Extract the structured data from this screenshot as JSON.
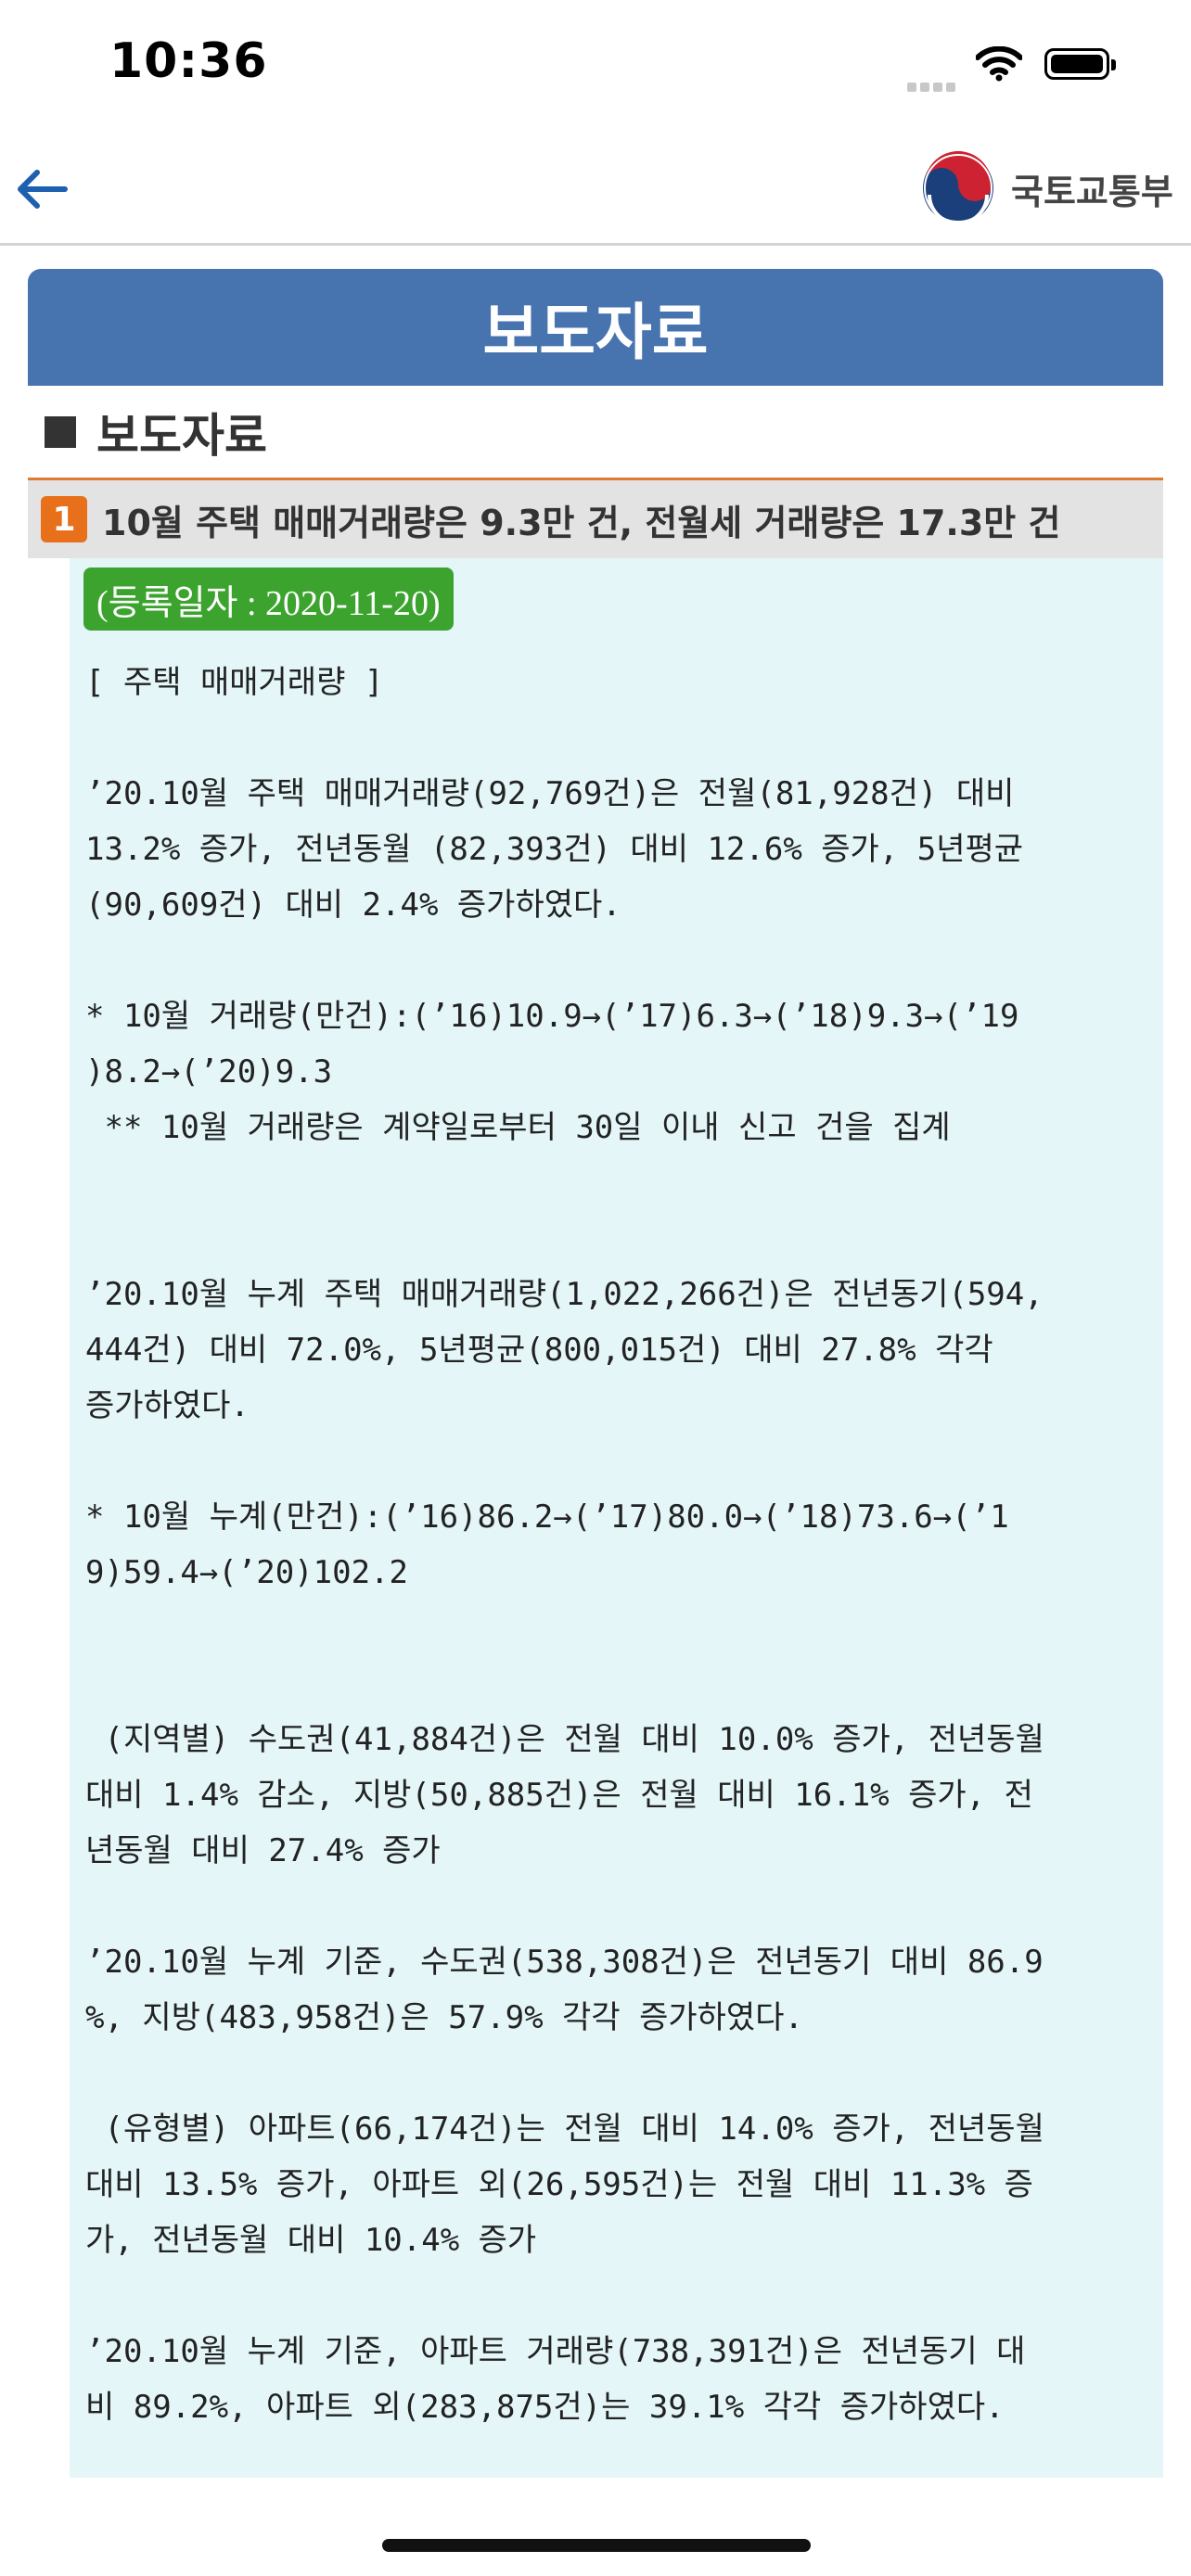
{
  "status_bar": {
    "time": "10:36"
  },
  "header": {
    "logo_text": "국토교통부"
  },
  "page": {
    "title": "보도자료",
    "section_heading": "보도자료"
  },
  "article": {
    "number": "1",
    "title": "10월 주택 매매거래량은 9.3만 건, 전월세 거래량은 17.3만 건",
    "date": "(등록일자 : 2020-11-20)",
    "paragraphs": [
      "[ 주택 매매거래량 ]",
      "’20.10월 주택 매매거래량(92,769건)은 전월(81,928건) 대비\n13.2% 증가, 전년동월 (82,393건) 대비 12.6% 증가, 5년평균\n(90,609건) 대비 2.4% 증가하였다.",
      "* 10월 거래량(만건):(’16)10.9→(’17)6.3→(’18)9.3→(’19\n)8.2→(’20)9.3\n ** 10월 거래량은 계약일로부터 30일 이내 신고 건을 집계",
      "’20.10월 누계 주택 매매거래량(1,022,266건)은 전년동기(594,\n444건) 대비 72.0%, 5년평균(800,015건) 대비 27.8% 각각\n증가하였다.",
      "* 10월 누계(만건):(’16)86.2→(’17)80.0→(’18)73.6→(’1\n9)59.4→(’20)102.2",
      " (지역별) 수도권(41,884건)은 전월 대비 10.0% 증가, 전년동월\n대비 1.4% 감소, 지방(50,885건)은 전월 대비 16.1% 증가, 전\n년동월 대비 27.4% 증가",
      "’20.10월 누계 기준, 수도권(538,308건)은 전년동기 대비 86.9\n%, 지방(483,958건)은 57.9% 각각 증가하였다.",
      " (유형별) 아파트(66,174건)는 전월 대비 14.0% 증가, 전년동월\n대비 13.5% 증가, 아파트 외(26,595건)는 전월 대비 11.3% 증\n가, 전년동월 대비 10.4% 증가",
      "’20.10월 누계 기준, 아파트 거래량(738,391건)은 전년동기 대\n비 89.2%, 아파트 외(283,875건)는 39.1% 각각 증가하였다."
    ]
  },
  "colors": {
    "title_bar": "#4773af",
    "badge_orange": "#e8701a",
    "date_green": "#3ca32e",
    "content_bg": "#e4f6f8",
    "back_arrow": "#1f5fb0"
  }
}
